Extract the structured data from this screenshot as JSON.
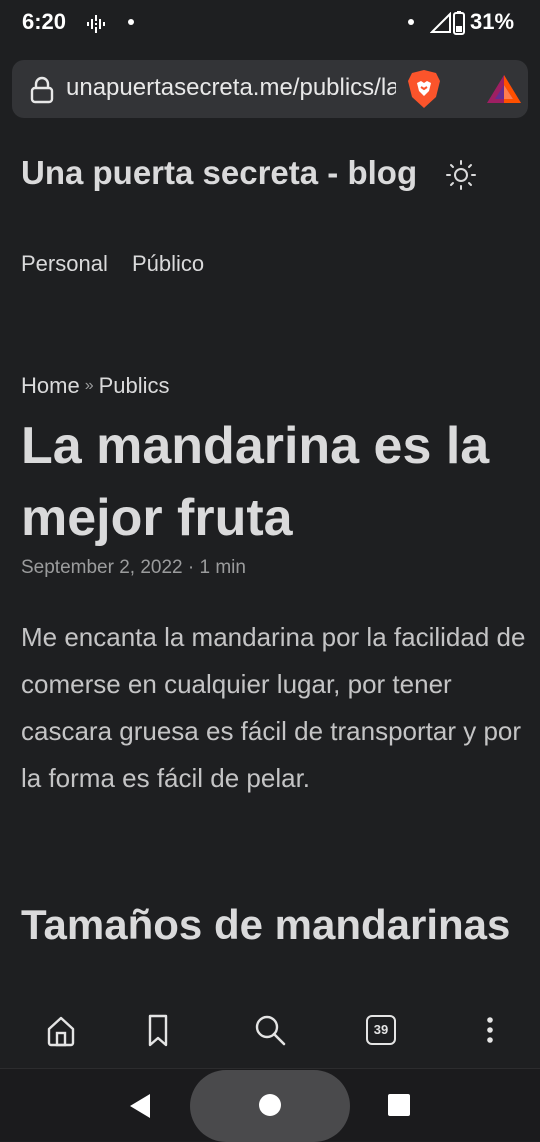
{
  "status_bar": {
    "time": "6:20",
    "battery": "31%",
    "icons": [
      "podcast-icon",
      "notification-dot",
      "wifi-dot",
      "signal-icon",
      "battery-icon"
    ]
  },
  "browser": {
    "url": "unapuertasecreta.me/publics/la-mandarina",
    "icons": [
      "lock-icon",
      "brave-shield-icon",
      "bat-rewards-icon"
    ],
    "toolbar": {
      "tab_count": "39",
      "icons": [
        "home-icon",
        "bookmark-icon",
        "search-icon",
        "tabs-icon",
        "more-menu-icon"
      ]
    }
  },
  "site": {
    "title": "Una puerta secreta - blog",
    "theme_icon": "sun-icon",
    "nav": [
      "Personal",
      "Público"
    ]
  },
  "breadcrumb": {
    "home": "Home",
    "separator": "»",
    "current": "Publics"
  },
  "post": {
    "title": "La mandarina es la mejor fruta",
    "meta": "September 2, 2022 · 1 min",
    "body": "Me encanta la mandarina por la facilidad de comerse en cualquier lugar, por tener cascara gruesa es fácil de transportar y por la forma es fácil de pelar.",
    "section_heading": "Tamaños de mandarinas"
  },
  "system_nav": {
    "icons": [
      "back-icon",
      "home-button",
      "recents-icon"
    ]
  },
  "colors": {
    "background": "#1e1f21",
    "text": "#dadadb",
    "secondary_text": "#9b9c9d",
    "url_bar": "#333437",
    "brave_orange": "#fb542b"
  }
}
